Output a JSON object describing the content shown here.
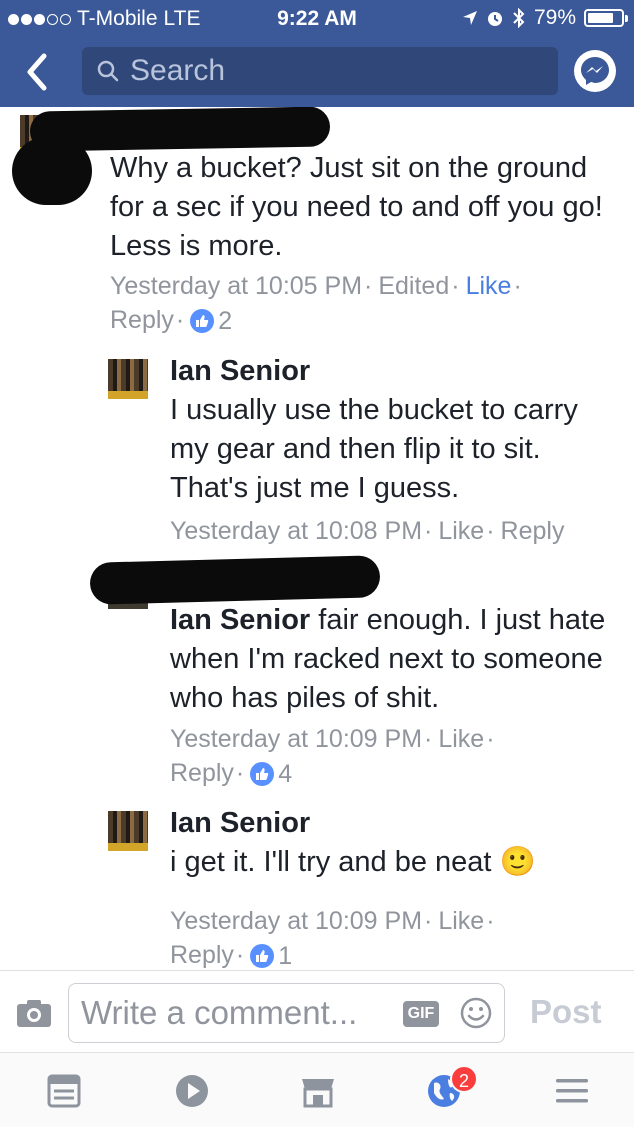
{
  "status_bar": {
    "carrier": "T-Mobile",
    "network": "LTE",
    "time": "9:22 AM",
    "battery": "79%",
    "battery_level": 0.79,
    "signal_bars": 3
  },
  "nav": {
    "search_placeholder": "Search"
  },
  "comments": [
    {
      "name": "",
      "text": "Why a bucket? Just sit on the ground for a sec if you need to and off you go! Less is more.",
      "timestamp": "Yesterday at 10:05 PM",
      "edited": "Edited",
      "like_label": "Like",
      "reply_label": "Reply",
      "reactions": "2"
    },
    {
      "name": "Ian Senior",
      "text": "I usually use the bucket to carry my gear and then flip it to sit. That's just me I guess.",
      "timestamp": "Yesterday at 10:08 PM",
      "like_label": "Like",
      "reply_label": "Reply"
    },
    {
      "name": "",
      "mention": "Ian Senior",
      "text": " fair enough. I just hate when I'm racked next to someone who has piles of shit.",
      "timestamp": "Yesterday at 10:09 PM",
      "like_label": "Like",
      "reply_label": "Reply",
      "reactions": "4"
    },
    {
      "name": "Ian Senior",
      "text": "i get it. I'll try and be neat ",
      "emoji": "🙂",
      "timestamp": "Yesterday at 10:09 PM",
      "like_label": "Like",
      "reply_label": "Reply",
      "reactions": "1"
    }
  ],
  "composer": {
    "placeholder": "Write a comment...",
    "gif_label": "GIF",
    "post_label": "Post"
  },
  "tabbar": {
    "notifications_badge": "2"
  },
  "colors": {
    "brand_blue": "#3b5998",
    "link_blue": "#4a7ee0",
    "like_blue": "#5890ff",
    "badge_red": "#fa3e3e"
  }
}
